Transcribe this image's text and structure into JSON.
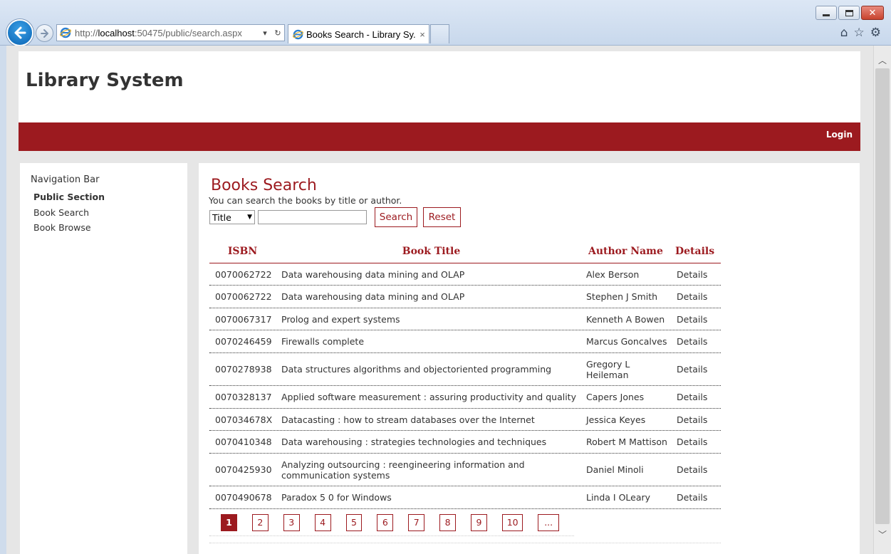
{
  "browser": {
    "url_prefix": "http://",
    "url_host": "localhost",
    "url_rest": ":50475/public/search.aspx",
    "tab_title": "Books Search - Library Sy...",
    "tab_close": "×"
  },
  "site": {
    "title": "Library System",
    "login_label": "Login"
  },
  "sidebar": {
    "heading": "Navigation Bar",
    "items": [
      {
        "label": "Public Section"
      },
      {
        "label": "Book Search"
      },
      {
        "label": "Book Browse"
      }
    ]
  },
  "search": {
    "title": "Books Search",
    "description": "You can search the books by title or author.",
    "field_selected": "Title",
    "query": "",
    "search_label": "Search",
    "reset_label": "Reset"
  },
  "table": {
    "headers": {
      "isbn": "ISBN",
      "title": "Book Title",
      "author": "Author Name",
      "details": "Details"
    },
    "rows": [
      {
        "isbn": "0070062722",
        "title": "Data warehousing data mining and OLAP",
        "author": "Alex Berson",
        "details": "Details"
      },
      {
        "isbn": "0070062722",
        "title": "Data warehousing data mining and OLAP",
        "author": "Stephen J Smith",
        "details": "Details"
      },
      {
        "isbn": "0070067317",
        "title": "Prolog and expert systems",
        "author": "Kenneth A Bowen",
        "details": "Details"
      },
      {
        "isbn": "0070246459",
        "title": "Firewalls complete",
        "author": "Marcus Goncalves",
        "details": "Details"
      },
      {
        "isbn": "0070278938",
        "title": "Data structures algorithms and objectoriented programming",
        "author": "Gregory L Heileman",
        "details": "Details"
      },
      {
        "isbn": "0070328137",
        "title": "Applied software measurement : assuring productivity and quality",
        "author": "Capers Jones",
        "details": "Details"
      },
      {
        "isbn": "007034678X",
        "title": "Datacasting : how to stream databases over the Internet",
        "author": "Jessica Keyes",
        "details": "Details"
      },
      {
        "isbn": "0070410348",
        "title": "Data warehousing : strategies technologies and techniques",
        "author": "Robert M Mattison",
        "details": "Details"
      },
      {
        "isbn": "0070425930",
        "title": "Analyzing outsourcing : reengineering information and communication systems",
        "author": "Daniel Minoli",
        "details": "Details"
      },
      {
        "isbn": "0070490678",
        "title": "Paradox 5 0 for Windows",
        "author": "Linda I OLeary",
        "details": "Details"
      }
    ]
  },
  "pager": {
    "pages": [
      "1",
      "2",
      "3",
      "4",
      "5",
      "6",
      "7",
      "8",
      "9",
      "10",
      "..."
    ],
    "current": "1"
  },
  "colors": {
    "accent": "#9c1a1f",
    "page_bg": "#e6e6e6"
  }
}
